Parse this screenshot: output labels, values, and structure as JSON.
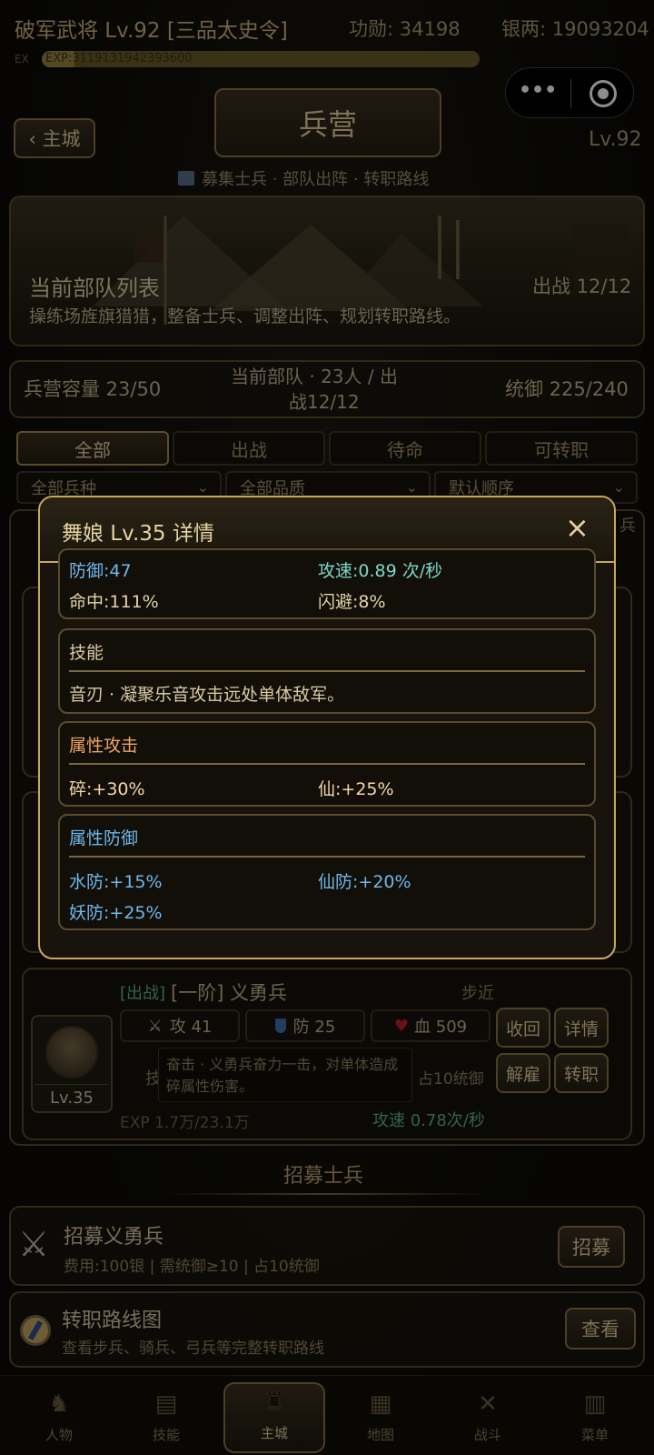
{
  "status_bar": {
    "name": "破军武将 Lv.92 [三品太史令]",
    "merit": "功勋: 34198",
    "silver": "银两: 19093204",
    "exp_prefix": "EX",
    "exp_text": "EXP:3119131942393600",
    "exp_fraction": 0.074
  },
  "header": {
    "back_label": "‹ 主城",
    "title": "兵营",
    "level": "Lv.92",
    "subtitle": "募集士兵 · 部队出阵 · 转职路线",
    "capsule_more": "•••",
    "capsule_target": "⦿"
  },
  "banner": {
    "title": "当前部队列表",
    "desc": "操练场旌旗猎猎，整备士兵、调整出阵、规划转职路线。",
    "deploy": "出战 12/12"
  },
  "summary": {
    "capacity": "兵营容量 23/50",
    "current_line1": "当前部队 · 23人 / 出",
    "current_line2": "战12/12",
    "command": "统御 225/240"
  },
  "tabs": [
    {
      "label": "全部",
      "active": true
    },
    {
      "label": "出战",
      "active": false
    },
    {
      "label": "待命",
      "active": false
    },
    {
      "label": "可转职",
      "active": false
    }
  ],
  "filters": [
    {
      "label": "全部兵种"
    },
    {
      "label": "全部品质"
    },
    {
      "label": "默认顺序"
    }
  ],
  "filter_side_char": "兵",
  "modal": {
    "title": "舞娘 Lv.35 详情",
    "close": "×",
    "stats_top": {
      "def": "防御:47",
      "speed": "攻速:0.89 次/秒",
      "hit": "命中:111%",
      "dodge": "闪避:8%"
    },
    "skill": {
      "header": "技能",
      "text": "音刃 · 凝聚乐音攻击远处单体敌军。"
    },
    "attr_attack": {
      "header": "属性攻击",
      "items": [
        "碎:+30%",
        "仙:+25%"
      ]
    },
    "attr_defense": {
      "header": "属性防御",
      "items": [
        "水防:+15%",
        "仙防:+20%",
        "妖防:+25%"
      ]
    }
  },
  "unit_card": {
    "status": "[出战]",
    "name": "[一阶] 义勇兵",
    "type": "步近",
    "level": "Lv.35",
    "attack": "攻 41",
    "defense": "防 25",
    "hp": "血 509",
    "skill_label": "技能",
    "skill_text": "奋击 · 义勇兵奋力一击，对单体造成碎属性伤害。",
    "command_cost": "占10统御",
    "exp": "EXP 1.7万/23.1万",
    "speed": "攻速 0.78次/秒",
    "buttons": {
      "recall": "收回",
      "detail": "详情",
      "dismiss": "解雇",
      "promote": "转职"
    }
  },
  "recruit_section": {
    "title": "招募士兵",
    "recruit": {
      "title": "招募义勇兵",
      "desc": "费用:100银 | 需统御≥10 | 占10统御",
      "button": "招募"
    },
    "route": {
      "title": "转职路线图",
      "desc": "查看步兵、骑兵、弓兵等完整转职路线",
      "button": "查看"
    }
  },
  "bottom_nav": [
    {
      "label": "人物",
      "icon": "person-icon",
      "active": false
    },
    {
      "label": "技能",
      "icon": "scroll-icon",
      "active": false
    },
    {
      "label": "主城",
      "icon": "castle-icon",
      "active": true
    },
    {
      "label": "地图",
      "icon": "map-icon",
      "active": false
    },
    {
      "label": "战斗",
      "icon": "crossed-swords-icon",
      "active": false
    },
    {
      "label": "菜单",
      "icon": "menu-scroll-icon",
      "active": false
    }
  ],
  "colors": {
    "gold": "#e3cf9c",
    "cyan": "#7fd6c8",
    "blue": "#6fb7ec",
    "orange": "#f0a36a",
    "green_status": "#5fb38a"
  }
}
